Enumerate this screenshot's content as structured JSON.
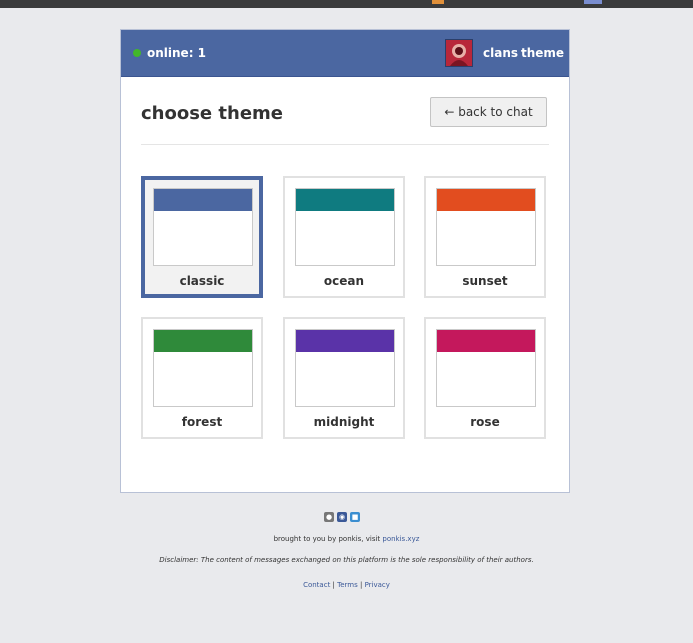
{
  "header": {
    "status_text": "online: 1",
    "nav": {
      "clans": "clans",
      "theme": "theme"
    }
  },
  "page": {
    "title": "choose theme",
    "back_button": "← back to chat"
  },
  "themes": [
    {
      "name": "classic",
      "color": "#4b67a1",
      "selected": true
    },
    {
      "name": "ocean",
      "color": "#0f7b80",
      "selected": false
    },
    {
      "name": "sunset",
      "color": "#e24d1f",
      "selected": false
    },
    {
      "name": "forest",
      "color": "#2f8a3a",
      "selected": false
    },
    {
      "name": "midnight",
      "color": "#5a33a8",
      "selected": false
    },
    {
      "name": "rose",
      "color": "#c4185c",
      "selected": false
    }
  ],
  "footer": {
    "credit_prefix": "brought to you by ponkis, visit ",
    "credit_link": "ponkis.xyz",
    "disclaimer": "Disclaimer: The content of messages exchanged on this platform is the sole responsibility of their authors.",
    "links": {
      "contact": "Contact",
      "terms": "Terms",
      "privacy": "Privacy"
    },
    "separator": " | "
  },
  "icons": {
    "status": "online-dot-icon",
    "avatar": "user-avatar",
    "footer": [
      "gamepad-icon",
      "discord-icon",
      "chat-icon"
    ]
  }
}
